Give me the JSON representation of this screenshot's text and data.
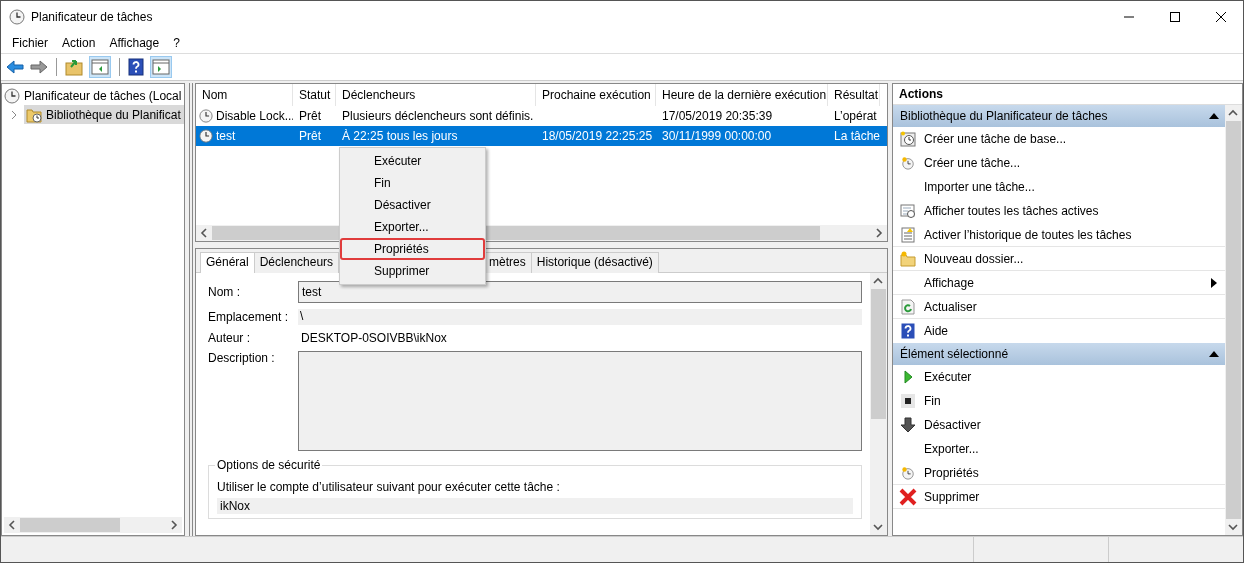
{
  "window": {
    "title": "Planificateur de tâches"
  },
  "menu": [
    "Fichier",
    "Action",
    "Affichage",
    "?"
  ],
  "tree": [
    {
      "label": "Planificateur de tâches (Local",
      "selected": false,
      "children": [
        {
          "label": "Bibliothèque du Planificat",
          "selected": true,
          "expanded": false
        }
      ]
    }
  ],
  "table": {
    "columns": [
      "Nom",
      "Statut",
      "Déclencheurs",
      "Prochaine exécution",
      "Heure de la dernière exécution",
      "Résultat"
    ],
    "rows": [
      {
        "selected": false,
        "cells": [
          "Disable Lock...",
          "Prêt",
          "Plusieurs déclencheurs sont définis.",
          "",
          "17/05/2019 20:35:39",
          "L’opérat"
        ]
      },
      {
        "selected": true,
        "cells": [
          "test",
          "Prêt",
          "À 22:25 tous les jours",
          "18/05/2019 22:25:25",
          "30/11/1999 00:00:00",
          "La tâche"
        ]
      }
    ]
  },
  "context_menu": [
    {
      "label": "Exécuter",
      "highlighted": false
    },
    {
      "label": "Fin",
      "highlighted": false
    },
    {
      "label": "Désactiver",
      "highlighted": false
    },
    {
      "label": "Exporter...",
      "highlighted": false
    },
    {
      "label": "Propriétés",
      "highlighted": true
    },
    {
      "label": "Supprimer",
      "highlighted": false
    }
  ],
  "tabs": [
    {
      "label": "Général",
      "selected": true
    },
    {
      "label": "Déclencheurs",
      "selected": false
    },
    {
      "label": "mètres",
      "selected": false
    },
    {
      "label": "Historique (désactivé)",
      "selected": false
    }
  ],
  "general": {
    "name_label": "Nom :",
    "name": "test",
    "location_label": "Emplacement :",
    "location": "\\",
    "author_label": "Auteur :",
    "author": "DESKTOP-0SOIVBB\\ikNox",
    "description_label": "Description :",
    "security": {
      "title": "Options de sécurité",
      "text": "Utiliser le compte d’utilisateur suivant pour exécuter cette tâche :",
      "account": "ikNox"
    }
  },
  "actions": {
    "title": "Actions",
    "sections": [
      {
        "title": "Bibliothèque du Planificateur de tâches",
        "expanded": true,
        "items": [
          {
            "label": "Créer une tâche de base...",
            "kind": "basic-task",
            "divider": false
          },
          {
            "label": "Créer une tâche...",
            "kind": "task",
            "divider": false
          },
          {
            "label": "Importer une tâche...",
            "kind": "plain",
            "divider": false
          },
          {
            "label": "Afficher toutes les tâches actives",
            "kind": "list",
            "divider": false
          },
          {
            "label": "Activer l’historique de toutes les tâches",
            "kind": "log",
            "divider": true
          },
          {
            "label": "Nouveau dossier...",
            "kind": "folder",
            "divider": true
          },
          {
            "label": "Affichage",
            "kind": "plain",
            "submenu": true,
            "divider": true
          },
          {
            "label": "Actualiser",
            "kind": "refresh",
            "divider": true
          },
          {
            "label": "Aide",
            "kind": "help",
            "divider": false
          }
        ]
      },
      {
        "title": "Élément sélectionné",
        "expanded": true,
        "items": [
          {
            "label": "Exécuter",
            "kind": "run",
            "divider": false
          },
          {
            "label": "Fin",
            "kind": "stop",
            "divider": false
          },
          {
            "label": "Désactiver",
            "kind": "disable",
            "divider": false
          },
          {
            "label": "Exporter...",
            "kind": "plain",
            "divider": false
          },
          {
            "label": "Propriétés",
            "kind": "task",
            "divider": true
          },
          {
            "label": "Supprimer",
            "kind": "delete",
            "divider": true
          }
        ]
      }
    ]
  }
}
